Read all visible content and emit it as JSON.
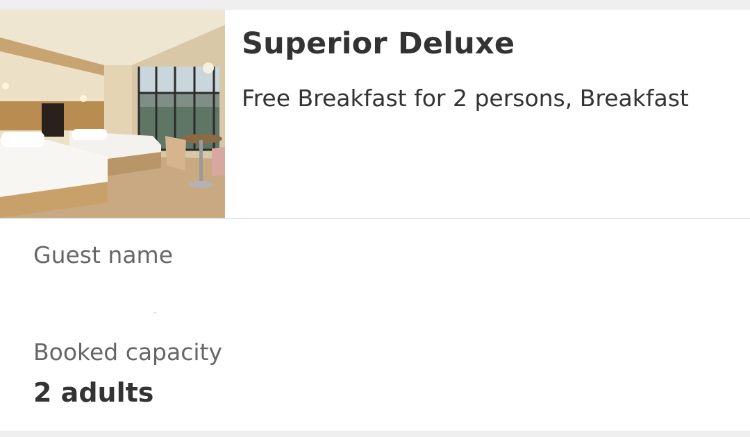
{
  "room": {
    "title": "Superior Deluxe",
    "meal_plan": "Free Breakfast for 2 persons, Breakfast",
    "photo_icon": "room-photo"
  },
  "guest": {
    "label": "Guest name",
    "value": ""
  },
  "capacity": {
    "label": "Booked capacity",
    "value": "2 adults"
  },
  "colors": {
    "background": "#efefef",
    "card": "#ffffff",
    "text_primary": "#333333",
    "text_secondary": "#666666",
    "divider": "#e6e6e6"
  }
}
